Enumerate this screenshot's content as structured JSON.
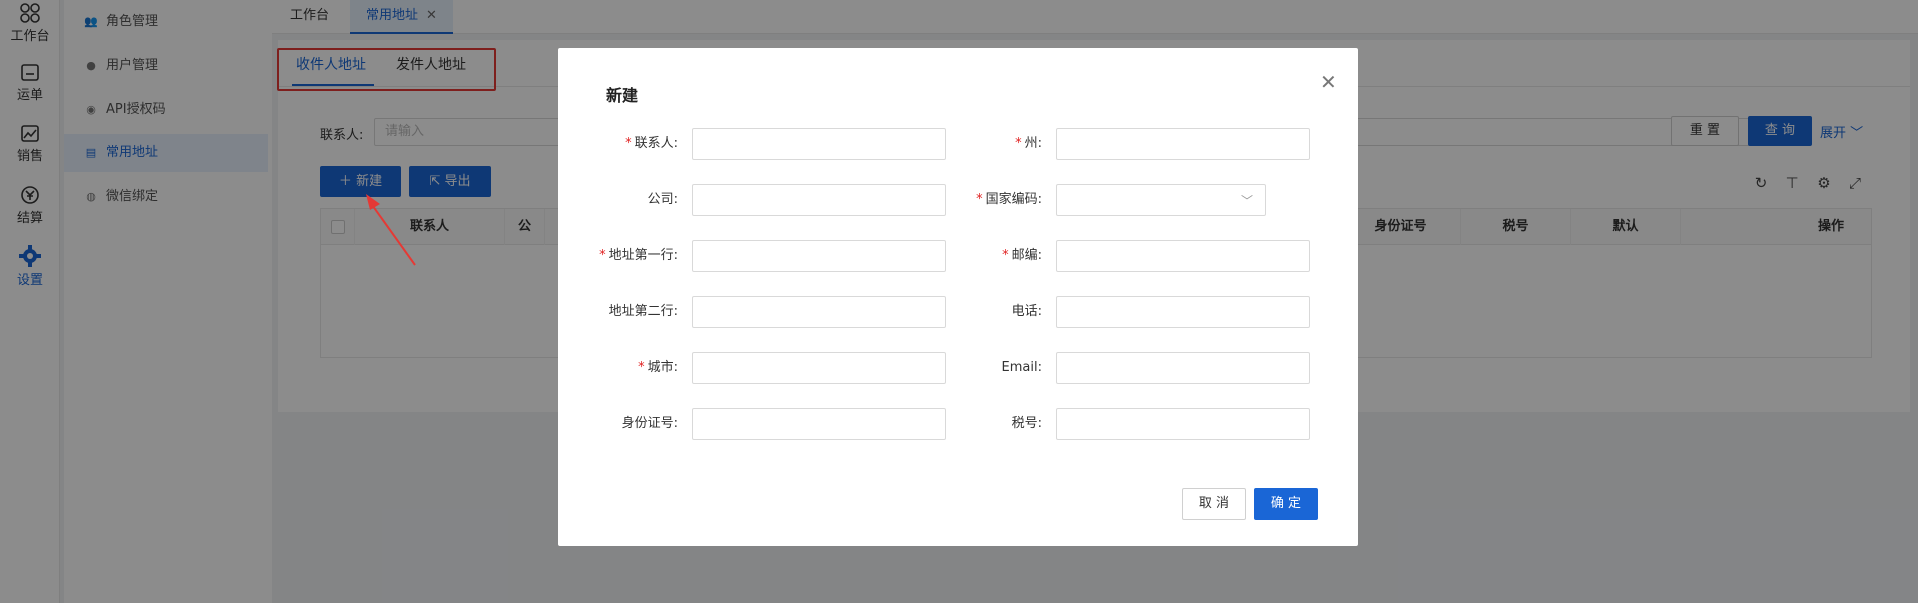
{
  "rail": [
    {
      "label": "工作台",
      "icon": "workbench-icon"
    },
    {
      "label": "运单",
      "icon": "waybill-icon"
    },
    {
      "label": "销售",
      "icon": "sales-icon"
    },
    {
      "label": "结算",
      "icon": "settlement-icon"
    },
    {
      "label": "设置",
      "icon": "settings-icon",
      "active": true
    }
  ],
  "menu": [
    {
      "label": "角色管理",
      "icon": "role-icon"
    },
    {
      "label": "用户管理",
      "icon": "user-icon"
    },
    {
      "label": "API授权码",
      "icon": "eye-icon"
    },
    {
      "label": "常用地址",
      "icon": "address-icon",
      "active": true
    },
    {
      "label": "微信绑定",
      "icon": "wechat-icon"
    }
  ],
  "tabs": [
    {
      "label": "工作台"
    },
    {
      "label": "常用地址",
      "active": true,
      "closable": true
    }
  ],
  "subtabs": [
    {
      "label": "收件人地址",
      "active": true
    },
    {
      "label": "发件人地址"
    }
  ],
  "filter": {
    "label": "联系人:",
    "placeholder": "请输入",
    "reset": "重 置",
    "query": "查 询",
    "expand": "展开"
  },
  "actions": {
    "new": "新建",
    "export": "导出"
  },
  "table": {
    "columns": [
      "联系人",
      "公",
      "身份证号",
      "税号",
      "默认",
      "操作"
    ]
  },
  "modal": {
    "title": "新建",
    "fields_left": [
      {
        "label": "联系人:",
        "required": true
      },
      {
        "label": "公司:",
        "required": false
      },
      {
        "label": "地址第一行:",
        "required": true
      },
      {
        "label": "地址第二行:",
        "required": false
      },
      {
        "label": "城市:",
        "required": true
      },
      {
        "label": "身份证号:",
        "required": false
      }
    ],
    "fields_right": [
      {
        "label": "州:",
        "required": true
      },
      {
        "label": "国家编码:",
        "required": true,
        "type": "select"
      },
      {
        "label": "邮编:",
        "required": true
      },
      {
        "label": "电话:",
        "required": false
      },
      {
        "label": "Email:",
        "required": false
      },
      {
        "label": "税号:",
        "required": false
      }
    ],
    "cancel": "取 消",
    "ok": "确 定"
  },
  "colors": {
    "primary": "#1a66d6",
    "required": "#e02020",
    "annotation": "#e53935"
  }
}
